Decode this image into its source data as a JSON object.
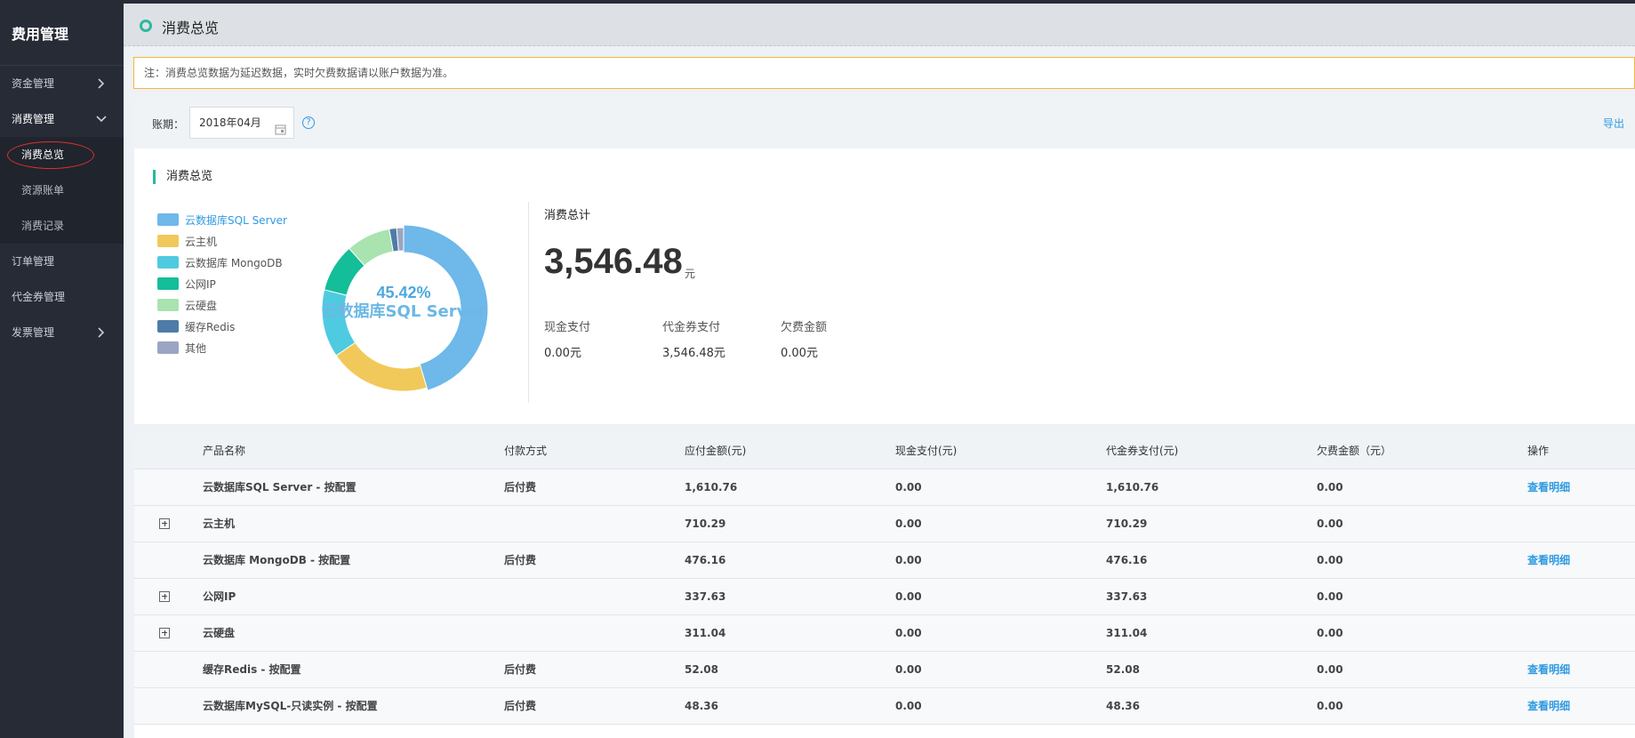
{
  "sidebar": {
    "title": "费用管理",
    "items": [
      {
        "label": "资金管理",
        "expanded": false
      },
      {
        "label": "消费管理",
        "expanded": true
      },
      {
        "label": "订单管理"
      },
      {
        "label": "代金券管理"
      },
      {
        "label": "发票管理",
        "expanded": false
      }
    ],
    "sub_items": [
      {
        "label": "消费总览",
        "active": true
      },
      {
        "label": "资源账单"
      },
      {
        "label": "消费记录"
      }
    ]
  },
  "header": {
    "title": "消费总览"
  },
  "notice": "注：消费总览数据为延迟数据，实时欠费数据请以账户数据为准。",
  "toolbar": {
    "period_label": "账期：",
    "period_value": "2018年04月",
    "help": "?",
    "export_label": "导出"
  },
  "overview": {
    "title": "消费总览",
    "legend": [
      {
        "label": "云数据库SQL Server",
        "color": "#6eb8ea"
      },
      {
        "label": "云主机",
        "color": "#f1c95a"
      },
      {
        "label": "云数据库 MongoDB",
        "color": "#4ecbe0"
      },
      {
        "label": "公网IP",
        "color": "#13be99"
      },
      {
        "label": "云硬盘",
        "color": "#a9e3b0"
      },
      {
        "label": "缓存Redis",
        "color": "#4e7ca8"
      },
      {
        "label": "其他",
        "color": "#9aa5c4"
      }
    ],
    "donut_center_pct": "45.42%",
    "donut_center_label": "云数据库SQL Server",
    "total_label": "消费总计",
    "total_value": "3,546.48",
    "total_unit": "元",
    "cash_label": "现金支付",
    "cash_value": "0.00元",
    "voucher_label": "代金券支付",
    "voucher_value": "3,546.48元",
    "owed_label": "欠费金额",
    "owed_value": "0.00元"
  },
  "chart_data": {
    "type": "pie",
    "categories": [
      "云数据库SQL Server",
      "云主机",
      "云数据库 MongoDB",
      "公网IP",
      "云硬盘",
      "缓存Redis",
      "其他"
    ],
    "values": [
      1610.76,
      710.29,
      476.16,
      337.63,
      311.04,
      52.08,
      48.36
    ],
    "colors": [
      "#6eb8ea",
      "#f1c95a",
      "#4ecbe0",
      "#13be99",
      "#a9e3b0",
      "#4e7ca8",
      "#9aa5c4"
    ],
    "legend": "left"
  },
  "table": {
    "headers": [
      "产品名称",
      "付款方式",
      "应付金额(元)",
      "现金支付(元)",
      "代金券支付(元)",
      "欠费金额（元）",
      "操作"
    ],
    "rows": [
      {
        "name": "云数据库SQL Server - 按配置",
        "payment": "后付费",
        "due": "1,610.76",
        "cash": "0.00",
        "voucher": "1,610.76",
        "owed": "0.00",
        "action": "查看明细",
        "expandable": false
      },
      {
        "name": "云主机",
        "payment": "",
        "due": "710.29",
        "cash": "0.00",
        "voucher": "710.29",
        "owed": "0.00",
        "action": "",
        "expandable": true
      },
      {
        "name": "云数据库 MongoDB - 按配置",
        "payment": "后付费",
        "due": "476.16",
        "cash": "0.00",
        "voucher": "476.16",
        "owed": "0.00",
        "action": "查看明细",
        "expandable": false
      },
      {
        "name": "公网IP",
        "payment": "",
        "due": "337.63",
        "cash": "0.00",
        "voucher": "337.63",
        "owed": "0.00",
        "action": "",
        "expandable": true
      },
      {
        "name": "云硬盘",
        "payment": "",
        "due": "311.04",
        "cash": "0.00",
        "voucher": "311.04",
        "owed": "0.00",
        "action": "",
        "expandable": true
      },
      {
        "name": "缓存Redis - 按配置",
        "payment": "后付费",
        "due": "52.08",
        "cash": "0.00",
        "voucher": "52.08",
        "owed": "0.00",
        "action": "查看明细",
        "expandable": false
      },
      {
        "name": "云数据库MySQL-只读实例 - 按配置",
        "payment": "后付费",
        "due": "48.36",
        "cash": "0.00",
        "voucher": "48.36",
        "owed": "0.00",
        "action": "查看明细",
        "expandable": false
      }
    ]
  }
}
